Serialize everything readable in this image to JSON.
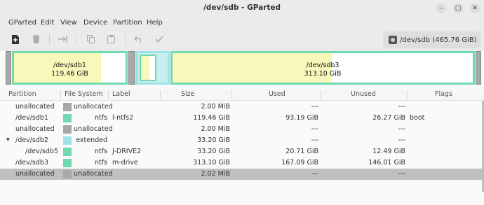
{
  "window": {
    "title": "/dev/sdb - GParted"
  },
  "menu": [
    "GParted",
    "Edit",
    "View",
    "Device",
    "Partition",
    "Help"
  ],
  "toolbar": {
    "buttons": [
      "new-icon",
      "delete-icon",
      "resize-move-icon",
      "copy-icon",
      "paste-icon",
      "undo-icon",
      "apply-icon"
    ],
    "device_label": "/dev/sdb (465.76 GiB)"
  },
  "diskmap": {
    "sdb1": {
      "name": "/dev/sdb1",
      "size": "119.46 GiB",
      "used_fraction": 0.78
    },
    "sdb3": {
      "name": "/dev/sdb3",
      "size": "313.10 GiB",
      "used_fraction": 0.53
    },
    "sdb5": {
      "used_fraction": 0.62
    }
  },
  "colors": {
    "ntfs": "#70d9b0",
    "extended": "#9fe3e6",
    "unallocated": "#a8a8a8",
    "used": "#f8f8ba",
    "selected_row": "#c0c0c0"
  },
  "table": {
    "headers": [
      "Partition",
      "File System",
      "Label",
      "Size",
      "Used",
      "Unused",
      "Flags"
    ],
    "rows": [
      {
        "partition": "unallocated",
        "fs": "unallocated",
        "label": "",
        "size": "2.00 MiB",
        "used": "---",
        "unused": "---",
        "flags": ""
      },
      {
        "partition": "/dev/sdb1",
        "fs": "ntfs",
        "label": "l-ntfs2",
        "size": "119.46 GiB",
        "used": "93.19 GiB",
        "unused": "26.27 GiB",
        "flags": "boot"
      },
      {
        "partition": "unallocated",
        "fs": "unallocated",
        "label": "",
        "size": "2.00 MiB",
        "used": "---",
        "unused": "---",
        "flags": ""
      },
      {
        "partition": "/dev/sdb2",
        "fs": "extended",
        "label": "",
        "size": "33.20 GiB",
        "used": "---",
        "unused": "---",
        "flags": ""
      },
      {
        "partition": "/dev/sdb5",
        "fs": "ntfs",
        "label": "J-DRIVE2",
        "size": "33.20 GiB",
        "used": "20.71 GiB",
        "unused": "12.49 GiB",
        "flags": ""
      },
      {
        "partition": "/dev/sdb3",
        "fs": "ntfs",
        "label": "m-drive",
        "size": "313.10 GiB",
        "used": "167.09 GiB",
        "unused": "146.01 GiB",
        "flags": ""
      },
      {
        "partition": "unallocated",
        "fs": "unallocated",
        "label": "",
        "size": "2.02 MiB",
        "used": "---",
        "unused": "---",
        "flags": ""
      }
    ]
  }
}
